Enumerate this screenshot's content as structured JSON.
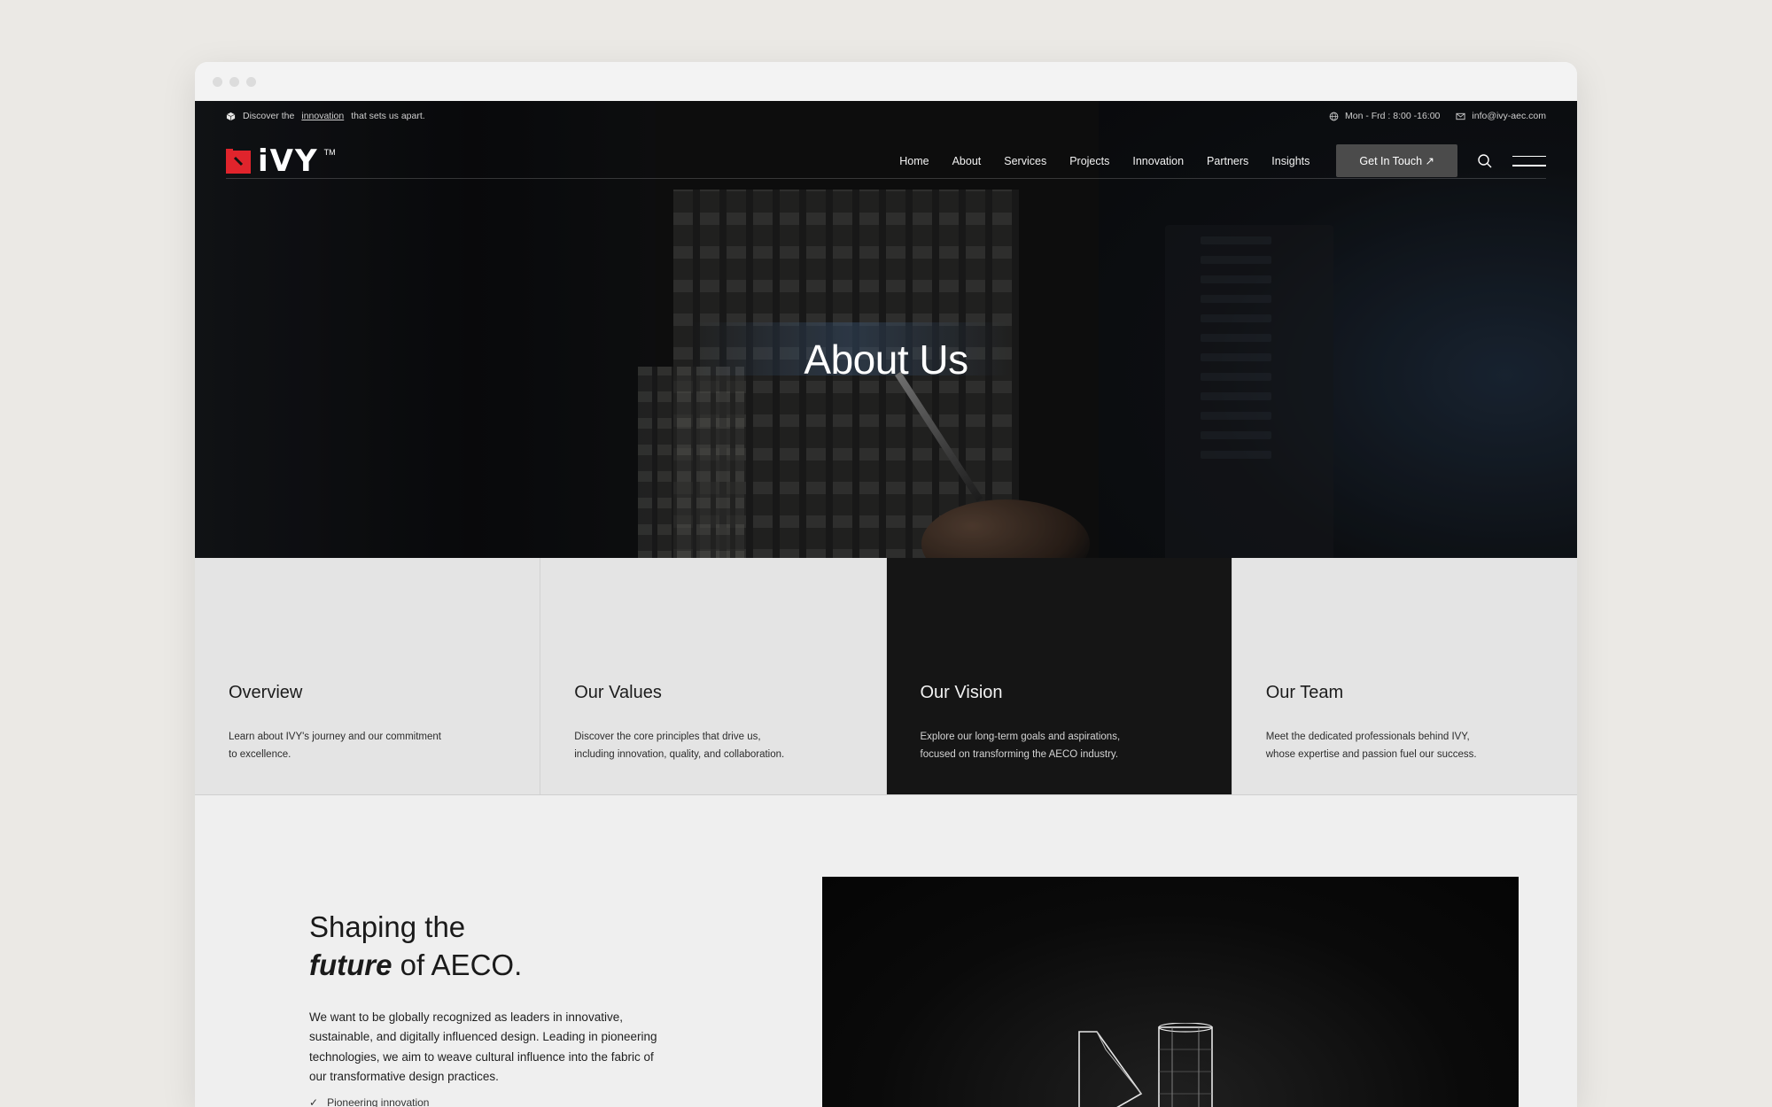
{
  "topbar": {
    "tagline_prefix": "Discover the",
    "tagline_link": "innovation",
    "tagline_suffix": "that sets us apart.",
    "hours": "Mon - Frd : 8:00 -16:00",
    "email": "info@ivy-aec.com"
  },
  "brand": {
    "name": "iVY",
    "tm": "TM",
    "accent": "#e0242c"
  },
  "nav": {
    "links": [
      "Home",
      "About",
      "Services",
      "Projects",
      "Innovation",
      "Partners",
      "Insights"
    ],
    "cta": "Get In Touch ↗"
  },
  "hero": {
    "title": "About Us"
  },
  "cards": [
    {
      "title": "Overview",
      "desc": "Learn about IVY's journey and our commitment to excellence."
    },
    {
      "title": "Our Values",
      "desc": "Discover the core principles that drive us, including innovation, quality, and collaboration."
    },
    {
      "title": "Our Vision",
      "desc": "Explore our long-term goals and aspirations, focused on transforming the AECO industry."
    },
    {
      "title": "Our Team",
      "desc": "Meet the dedicated professionals behind IVY, whose expertise and passion fuel our success."
    }
  ],
  "section": {
    "heading_line1": "Shaping the",
    "heading_em": "future",
    "heading_rest": "of AECO.",
    "body": "We want to be globally recognized as leaders in innovative, sustainable, and digitally influenced design. Leading in pioneering technologies, we aim to weave cultural influence into the fabric of our transformative design practices.",
    "bullet": "Pioneering innovation"
  }
}
